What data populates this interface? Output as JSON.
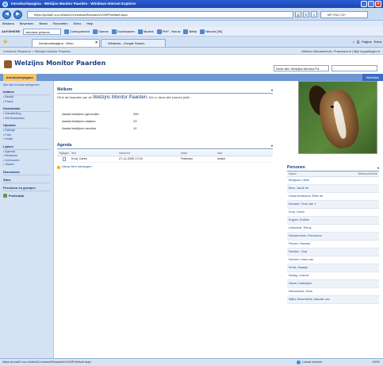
{
  "browser": {
    "title": "Introductiepagina - Welzijns Monitor Paarden - Windows Internet Explorer",
    "address": "https://portal2.vuu.nl/sites2/LivestockResearch/UVMP/default.aspx",
    "search_placeholder": "MP-FAQ 23+",
    "menu": [
      "Bestand",
      "Bewerken",
      "Beeld",
      "Favorieten",
      "Extra",
      "Help"
    ],
    "toolbar_input": "windows pictures",
    "toolbar_items": [
      "Zoekopdracht",
      "Games",
      "Downloaden",
      "Muziek",
      "PHP - Nieuw",
      "Bellia",
      "Nieuws [90]"
    ],
    "tabs": [
      {
        "label": "Introductiepagina - Welz..."
      },
      {
        "label": "Windows - Google Search"
      }
    ],
    "tab_tools": [
      "Pagina",
      "Extra"
    ],
    "statusbar": {
      "url": "https://portal2.vuu.nl/sites2/LivestockResearch/UVMP/default.aspx",
      "zone": "Lokaal intranet",
      "zoom": "100%"
    }
  },
  "site": {
    "breadcrumb": "Livestock Research > Welzijns Monitor Paarden",
    "welcome": "Welkom Nieuwenhuis, Francesca ▾ | Mijn koppelingen ▾",
    "title": "Welzijns Monitor Paarden",
    "search_scope": "Deze site: Welzijns Monitor Pa",
    "top_tab": "Introductiepagina",
    "top_right": "Websites"
  },
  "leftnav": {
    "view_all": "Alle site-inhoud weergeven",
    "sections": [
      {
        "heading": "Intakes",
        "items": [
          "Bedrijf",
          "Paard"
        ]
      },
      {
        "heading": "Downloads",
        "items": [
          "Handleiding",
          "Wlt Bestanden"
        ]
      },
      {
        "heading": "Uploads",
        "items": [
          "Nalistje",
          "Foto",
          "Invlije"
        ]
      },
      {
        "heading": "Lijsten",
        "items": [
          "Agenda",
          "Bedrijven",
          "Gebouwen",
          "Stallen"
        ]
      },
      {
        "heading": "Discussies",
        "items": []
      },
      {
        "heading": "Sites",
        "items": []
      },
      {
        "heading": "Personen en groepen",
        "items": []
      }
    ],
    "recycle": "Prullenbak"
  },
  "welkom": {
    "title": "Welkom",
    "intro_before": "Dit is de teamsite van de",
    "intro_big": "Welzijns Monitor Paarden.",
    "intro_after": "M.b.v. deze site kunnen jullie ...",
    "stats": [
      {
        "label": "Aantal bedrijven gevonden",
        "value": "250"
      },
      {
        "label": "Aantal bedrijven intakes",
        "value": "23"
      },
      {
        "label": "Aantal bedrijven monitor",
        "value": "12"
      }
    ]
  },
  "agenda": {
    "title": "Agenda",
    "columns": [
      "Bijlagen",
      "Wie",
      "Wanneer",
      "Waar",
      "Wat"
    ],
    "rows": [
      {
        "who": "Kruij, Caren",
        "when": "27-11-2009 17:00",
        "where": "Paterson",
        "what": "Intake"
      }
    ],
    "add": "Nieuw item toevoegen"
  },
  "personen": {
    "title": "Personen",
    "col_name": "Naam",
    "col_phone": "Telefoon/Mobiel",
    "people": [
      "Berghuis, Henk",
      "Boer, Jacob de",
      "Graaf-Koelkema, Ellen de",
      "Klooster, Teus van 't",
      "Kruij, Caren",
      "Kuyper, Robbin",
      "Lebschutt, Remy",
      "Nieuwenhuis, Francesca",
      "Plenen, Hannah",
      "Randen, Yara",
      "Reenen, Kees van",
      "Smits, Maartje",
      "Stadig, Leanne",
      "Visser, Kathelijne",
      "Weesselink, Henk",
      "Wijhe-Nesenbrink, Maudie van"
    ]
  }
}
